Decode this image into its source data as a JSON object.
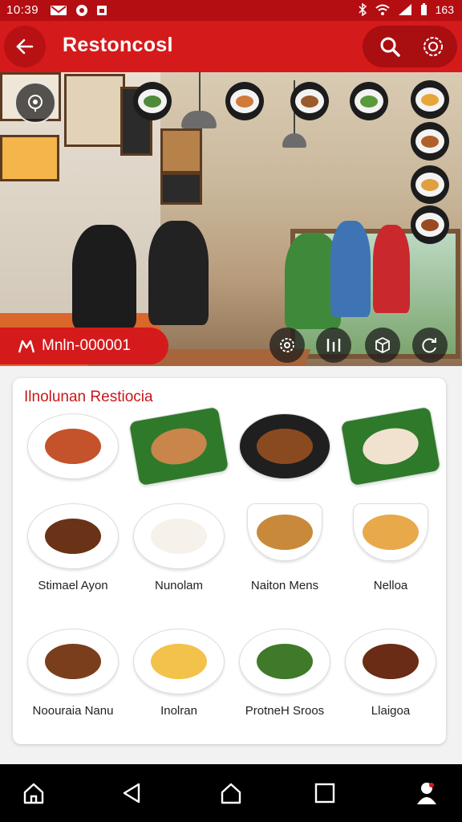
{
  "status": {
    "time": "10:39",
    "battery": "163"
  },
  "appbar": {
    "title": "Restoncosl",
    "back_icon": "back-arrow-icon",
    "search_icon": "search-icon",
    "settings_icon": "gear-icon"
  },
  "hero": {
    "chip_label": "Mnln-000001",
    "left_fabs": [
      "location-pin-icon",
      "dish-thumb-icon"
    ],
    "bottom_fabs": [
      "gear-icon",
      "stats-icon",
      "cube-icon",
      "refresh-icon"
    ]
  },
  "menu": {
    "title": "Ilnolunan Restiocia",
    "items": [
      {
        "label": "",
        "food_color": "#c4522a",
        "plate": "white"
      },
      {
        "label": "",
        "food_color": "#c9854a",
        "plate": "leaf"
      },
      {
        "label": "",
        "food_color": "#8a4a20",
        "plate": "black"
      },
      {
        "label": "",
        "food_color": "#f1e2cf",
        "plate": "leaf"
      },
      {
        "label": "Stimael Ayon",
        "food_color": "#6a3216",
        "plate": "white"
      },
      {
        "label": "Nunolam",
        "food_color": "#f6f1ea",
        "plate": "white"
      },
      {
        "label": "Naiton Mens",
        "food_color": "#c88a3a",
        "plate": "bowl"
      },
      {
        "label": "Nelloa",
        "food_color": "#e8a94a",
        "plate": "bowl"
      },
      {
        "label": "Noouraia Nanu",
        "food_color": "#7a3e1c",
        "plate": "white"
      },
      {
        "label": "Inolran",
        "food_color": "#f2c24a",
        "plate": "white"
      },
      {
        "label": "ProtneH Sroos",
        "food_color": "#3e7a2a",
        "plate": "white"
      },
      {
        "label": "Llaigoa",
        "food_color": "#6a2c14",
        "plate": "white"
      }
    ]
  },
  "navbar": [
    "home-icon",
    "back-triangle-icon",
    "home-house-icon",
    "recents-square-icon",
    "profile-icon"
  ]
}
